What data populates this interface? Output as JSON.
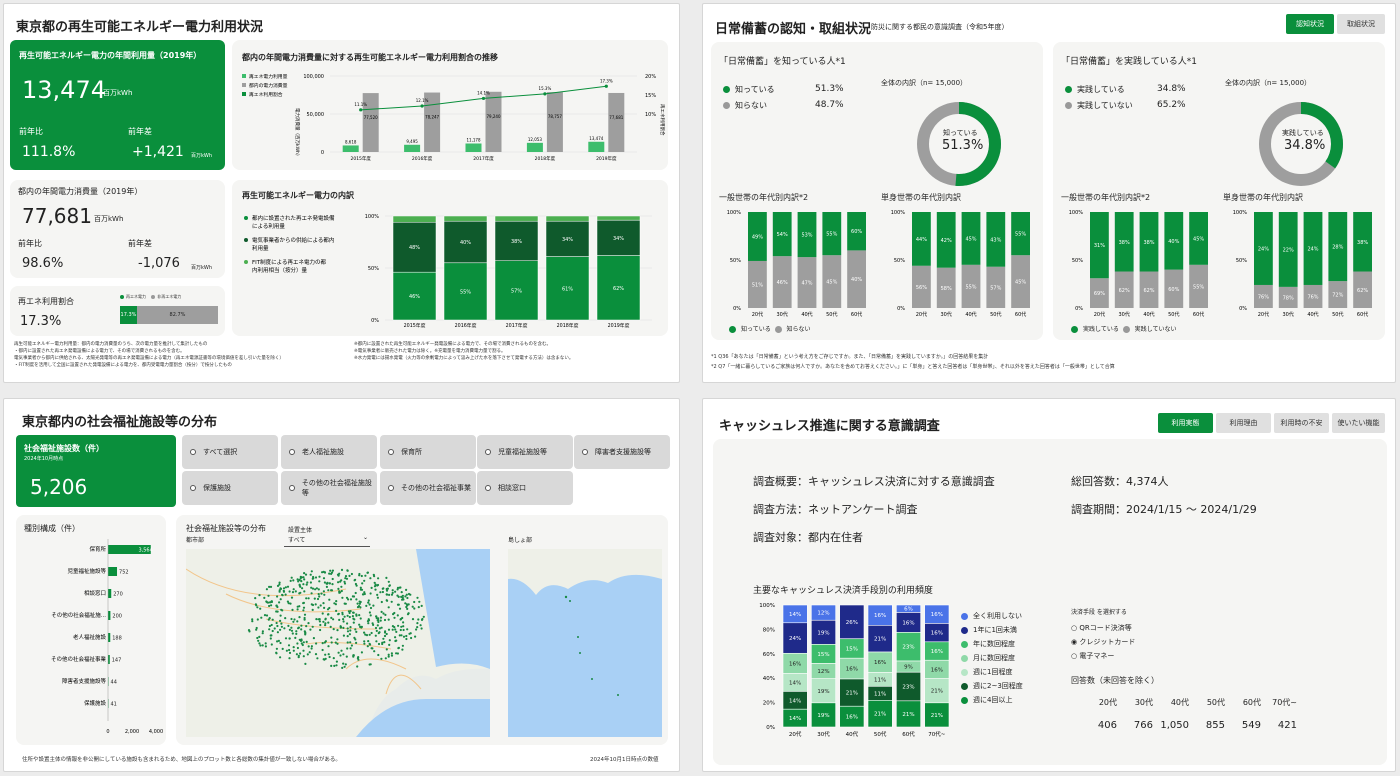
{
  "p1": {
    "title": "東京都の再生可能エネルギー電力利用状況",
    "kpi1": {
      "label": "再生可能エネルギー電力の年間利用量（2019年）",
      "value": "13,474",
      "unit": "百万kWh",
      "yoy_label": "前年比",
      "yoy": "111.8%",
      "diff_label": "前年差",
      "diff": "+1,421",
      "diff_unit": "百万kWh"
    },
    "kpi2": {
      "label": "都内の年間電力消費量（2019年）",
      "value": "77,681",
      "unit": "百万kWh",
      "yoy_label": "前年比",
      "yoy": "98.6%",
      "diff_label": "前年差",
      "diff": "-1,076",
      "diff_unit": "百万kWh"
    },
    "kpi3": {
      "label": "再エネ利用割合",
      "value": "17.3%",
      "legend1": "再エネ電力",
      "legend2": "非再エネ電力",
      "seg1": "17.3%",
      "seg2": "82.7%",
      "share": 0.173
    },
    "chart1": {
      "title": "都内の年間電力消費量に対する再生可能エネルギー電力利用割合の推移",
      "legend": [
        "再エネ電力利用量",
        "都内の電力消費量",
        "再エネ利用割合"
      ],
      "ylabel": "電力消費量（百万kWh）",
      "y2label": "再エネ利用割合",
      "yticks": [
        "100,000",
        "50,000",
        "0"
      ],
      "y2ticks": [
        "20%",
        "15%",
        "10%"
      ]
    },
    "chart2": {
      "title": "再生可能エネルギー電力の内訳",
      "legend": [
        "都内に設置された再エネ発電設備による利用量",
        "電気事業者からの供給による都内利用量",
        "FIT制度による再エネ電力の都内利用相当（按分）量"
      ],
      "yticks": [
        "100%",
        "50%",
        "0%"
      ]
    },
    "notes": [
      "再生可能エネルギー電力利用量：都内の電力消費量のうち、次の電力量を推計して集計したもの",
      "・都内に設置された再エネ発電設備による電力で、その場で消費されるものを含む。",
      "電気事業者から都内に供給される、太陽光発電等の再エネ発電設備による電力（再エネ電源証書等の環境価値を差し引いた量を除く）",
      "・FIT制度を活用して全国に設置された発電設備による電力を、都内受電電力量割合（按分）で按分したもの",
      "※都内に設置された再生可能エネルギー発電設備による電力で、その場で消費されるものを含む。",
      "※電気事業者に販売された電力は除く。※充電量を電力消費電力量で割る。",
      "※水力発電には揚水発電（火力等の余剰電力によって汲み上げた水を落下させて発電する方法）は含まない。"
    ]
  },
  "p2": {
    "title": "日常備蓄の認知・取組状況",
    "subtitle": "防災に関する都民の意識調査（令和5年度）",
    "tabs": [
      "認知状況",
      "取組状況"
    ],
    "left": {
      "title": "「日常備蓄」を知っている人*1",
      "opt1": "知っている",
      "v1": "51.3%",
      "opt2": "知らない",
      "v2": "48.7%",
      "total": "全体の内訳（n= 15,000）",
      "donut_label": "知っている",
      "donut_value": "51.3%",
      "share": 0.513
    },
    "right": {
      "title": "「日常備蓄」を実践している人*1",
      "opt1": "実践している",
      "v1": "34.8%",
      "opt2": "実践していない",
      "v2": "65.2%",
      "total": "全体の内訳（n= 15,000）",
      "donut_label": "実践している",
      "donut_value": "34.8%",
      "share": 0.348
    },
    "sub1": "一般世帯の年代別内訳*2",
    "sub2": "単身世帯の年代別内訳",
    "footnotes": [
      "*1 Q36「あなたは「日常備蓄」という考え方をご存じですか。また、「日常備蓄」を実践していますか。」の回答結果を集計",
      "*2 Q7「一緒に暮らしているご家族は何人ですか。あなたを含めてお答えください。」に「単身」と答えた回答者は「単身世帯」、それ以外を答えた回答者は「一般世帯」として合算"
    ]
  },
  "p3": {
    "title": "東京都内の社会福祉施設等の分布",
    "kpi": {
      "label": "社会福祉施設数（件）",
      "date": "2024年10月時点",
      "value": "5,206"
    },
    "filters": [
      "すべて選択",
      "老人福祉施設",
      "保育所",
      "児童福祉施設等",
      "障害者支援施設等",
      "保護施設",
      "その他の社会福祉施設等",
      "その他の社会福祉事業",
      "相談窓口"
    ],
    "bar_title": "種別構成（件）",
    "map_title": "社会福祉施設等の分布",
    "operator_label": "設置主体",
    "operator_value": "すべて",
    "area1": "都市部",
    "area2": "島しょ部",
    "footer": "住所や設置主体の情報を非公開にしている施設も含まれるため、地図上のプロット数と各総数の集計値が一致しない場合がある。",
    "date_note": "2024年10月1日時点の数値"
  },
  "p4": {
    "title": "キャッシュレス推進に関する意識調査",
    "tabs": [
      "利用実態",
      "利用理由",
      "利用時の不安",
      "使いたい機能"
    ],
    "info": [
      "調査概要：キャッシュレス決済に対する意識調査",
      "調査方法：ネットアンケート調査",
      "調査対象：都内在住者",
      "総回答数：4,374人",
      "調査期間：2024/1/15 ～ 2024/1/29"
    ],
    "chart_title": "主要なキャッシュレス決済手段別の利用頻度",
    "legend": [
      "全く利用しない",
      "1年に1回未満",
      "年に数回程度",
      "月に数回程度",
      "週に1回程度",
      "週に2~3回程度",
      "週に4回以上"
    ],
    "select_label": "決済手段 を選択する",
    "options": [
      "QRコード決済等",
      "クレジットカード",
      "電子マネー"
    ],
    "resp_title": "回答数（未回答を除く）",
    "resp_headers": [
      "20代",
      "30代",
      "40代",
      "50代",
      "60代",
      "70代~"
    ],
    "resp_values": [
      "406",
      "766",
      "1,050",
      "855",
      "549",
      "421"
    ]
  },
  "chart_data": [
    {
      "type": "bar",
      "title": "都内の年間電力消費量に対する再生可能エネルギー電力利用割合の推移",
      "categories": [
        "2015年度",
        "2016年度",
        "2017年度",
        "2018年度",
        "2019年度"
      ],
      "series": [
        {
          "name": "再エネ電力利用量",
          "values": [
            8618,
            9495,
            11178,
            12053,
            13474
          ]
        },
        {
          "name": "都内の電力消費量",
          "values": [
            77520,
            78247,
            79240,
            78757,
            77681
          ]
        },
        {
          "name": "再エネ利用割合",
          "values": [
            11.1,
            12.1,
            14.1,
            15.3,
            17.3
          ]
        }
      ],
      "ylim": [
        0,
        100000
      ],
      "y2lim": [
        0,
        20
      ]
    },
    {
      "type": "bar",
      "title": "再生可能エネルギー電力の内訳",
      "categories": [
        "2015年度",
        "2016年度",
        "2017年度",
        "2018年度",
        "2019年度"
      ],
      "series": [
        {
          "name": "FIT制度による再エネ電力の都内利用相当（按分）量",
          "values": [
            46,
            55,
            57,
            61,
            62
          ]
        },
        {
          "name": "電気事業者からの供給による都内利用量",
          "values": [
            48,
            40,
            38,
            34,
            34
          ]
        },
        {
          "name": "都内に設置された再エネ発電設備による利用量",
          "values": [
            6,
            5,
            5,
            5,
            4
          ]
        }
      ],
      "ylim": [
        0,
        100
      ]
    },
    {
      "type": "pie",
      "values": [
        51.3,
        48.7
      ],
      "categories": [
        "知っている",
        "知らない"
      ]
    },
    {
      "type": "bar",
      "title": "一般世帯の年代別内訳*2",
      "categories": [
        "20代",
        "30代",
        "40代",
        "50代",
        "60代"
      ],
      "series": [
        {
          "name": "知っている",
          "values": [
            49,
            54,
            53,
            55,
            60
          ]
        },
        {
          "name": "知らない",
          "values": [
            51,
            46,
            47,
            45,
            40
          ]
        }
      ]
    },
    {
      "type": "bar",
      "title": "単身世帯の年代別内訳",
      "categories": [
        "20代",
        "30代",
        "40代",
        "50代",
        "60代"
      ],
      "series": [
        {
          "name": "知っている",
          "values": [
            44,
            42,
            45,
            43,
            55
          ]
        },
        {
          "name": "知らない",
          "values": [
            56,
            58,
            55,
            57,
            45
          ]
        }
      ]
    },
    {
      "type": "pie",
      "values": [
        34.8,
        65.2
      ],
      "categories": [
        "実践している",
        "実践していない"
      ]
    },
    {
      "type": "bar",
      "title": "一般世帯の年代別内訳*2",
      "categories": [
        "20代",
        "30代",
        "40代",
        "50代",
        "60代"
      ],
      "series": [
        {
          "name": "実践している",
          "values": [
            31,
            38,
            38,
            40,
            45
          ]
        },
        {
          "name": "実践していない",
          "values": [
            69,
            62,
            62,
            60,
            55
          ]
        }
      ]
    },
    {
      "type": "bar",
      "title": "単身世帯の年代別内訳",
      "categories": [
        "20代",
        "30代",
        "40代",
        "50代",
        "60代"
      ],
      "series": [
        {
          "name": "実践している",
          "values": [
            24,
            22,
            24,
            28,
            38
          ]
        },
        {
          "name": "実践していない",
          "values": [
            76,
            78,
            76,
            72,
            62
          ]
        }
      ]
    },
    {
      "type": "bar",
      "title": "種別構成（件）",
      "categories": [
        "保育所",
        "児童福祉施設等",
        "相談窓口",
        "その他の社会福祉施...",
        "老人福祉施設",
        "その他の社会福祉事業",
        "障害者支援施設等",
        "保護施設"
      ],
      "values": [
        3564,
        752,
        270,
        200,
        188,
        147,
        44,
        41
      ],
      "xticks": [
        "0",
        "2,000",
        "4,000"
      ],
      "xlim": [
        0,
        4000
      ]
    },
    {
      "type": "bar",
      "title": "主要なキャッシュレス決済手段別の利用頻度",
      "categories": [
        "20代",
        "30代",
        "40代",
        "50代",
        "60代",
        "70代~"
      ],
      "series": [
        {
          "name": "全く利用しない",
          "values": [
            14,
            12,
            0,
            16,
            6,
            16
          ]
        },
        {
          "name": "1年に1回未満",
          "values": [
            24,
            19,
            26,
            21,
            16,
            16
          ]
        },
        {
          "name": "年に数回程度",
          "values": [
            0,
            15,
            15,
            0,
            23,
            16
          ]
        },
        {
          "name": "月に数回程度",
          "values": [
            16,
            12,
            16,
            16,
            9,
            16
          ]
        },
        {
          "name": "週に1回程度",
          "values": [
            14,
            19,
            0,
            11,
            0,
            21
          ]
        },
        {
          "name": "週に2~3回程度",
          "values": [
            14,
            0,
            21,
            11,
            23,
            0
          ]
        },
        {
          "name": "週に4回以上",
          "values": [
            14,
            19,
            16,
            21,
            21,
            21
          ]
        }
      ],
      "ylim": [
        0,
        100
      ],
      "yticks": [
        "100%",
        "80%",
        "60%",
        "40%",
        "20%",
        "0%"
      ]
    }
  ]
}
